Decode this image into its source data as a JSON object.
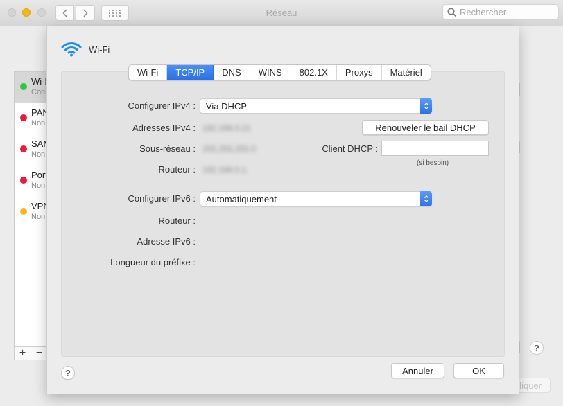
{
  "window": {
    "title": "Réseau",
    "search_placeholder": "Rechercher"
  },
  "sidebar": {
    "services": [
      {
        "name": "Wi-Fi",
        "status": "Connecté",
        "color": "#2ac940",
        "selected": true
      },
      {
        "name": "PAN",
        "status": "Non connecté",
        "color": "#f2183a",
        "selected": false
      },
      {
        "name": "SAMSUNG",
        "status": "Non connecté",
        "color": "#f2183a",
        "selected": false
      },
      {
        "name": "Port",
        "status": "Non connecté",
        "color": "#f2183a",
        "selected": false
      },
      {
        "name": "VPN",
        "status": "Non connecté",
        "color": "#fbb714",
        "selected": false
      }
    ],
    "add_label": "+",
    "remove_label": "−"
  },
  "background": {
    "help_label": "?",
    "apply_label": "Appliquer"
  },
  "sheet": {
    "interface_name": "Wi-Fi",
    "tabs": [
      {
        "label": "Wi-Fi",
        "active": false
      },
      {
        "label": "TCP/IP",
        "active": true
      },
      {
        "label": "DNS",
        "active": false
      },
      {
        "label": "WINS",
        "active": false
      },
      {
        "label": "802.1X",
        "active": false
      },
      {
        "label": "Proxys",
        "active": false
      },
      {
        "label": "Matériel",
        "active": false
      }
    ],
    "ipv4": {
      "configure_label": "Configurer IPv4 :",
      "configure_value": "Via DHCP",
      "address_label": "Adresses IPv4 :",
      "address_value": "192.168.0.21",
      "subnet_label": "Sous-réseau :",
      "subnet_value": "255.255.255.0",
      "router_label": "Routeur :",
      "router_value": "192.168.0.1",
      "renew_button": "Renouveler le bail DHCP",
      "dhcp_client_label": "Client DHCP :",
      "dhcp_client_value": "",
      "dhcp_client_hint": "(si besoin)"
    },
    "ipv6": {
      "configure_label": "Configurer IPv6 :",
      "configure_value": "Automatiquement",
      "router_label": "Routeur :",
      "address_label": "Adresse IPv6 :",
      "prefix_label": "Longueur du préfixe :"
    },
    "help_label": "?",
    "cancel_button": "Annuler",
    "ok_button": "OK"
  },
  "colors": {
    "accent": "#2b70e8",
    "wifi_icon": "#1e8ef0"
  }
}
